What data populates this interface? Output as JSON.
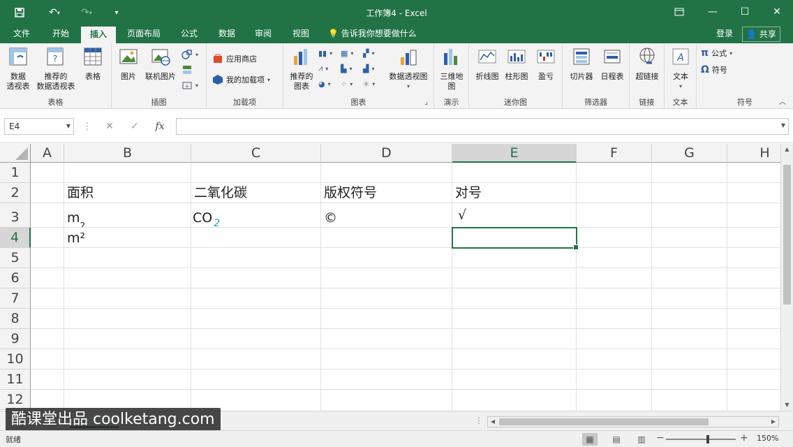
{
  "window": {
    "title": "工作簿4 - Excel"
  },
  "quick_access": {
    "save_icon": "save-icon",
    "undo_icon": "undo-icon",
    "redo_icon": "redo-icon"
  },
  "tabs": [
    {
      "label": "文件"
    },
    {
      "label": "开始"
    },
    {
      "label": "插入"
    },
    {
      "label": "页面布局"
    },
    {
      "label": "公式"
    },
    {
      "label": "数据"
    },
    {
      "label": "审阅"
    },
    {
      "label": "视图"
    }
  ],
  "tellme": "告诉我你想要做什么",
  "account": {
    "login": "登录",
    "share": "共享"
  },
  "ribbon": {
    "tables": {
      "label": "表格",
      "pivot": "数据\n透视表",
      "recommended_pivot": "推荐的\n数据透视表",
      "table": "表格"
    },
    "illustrations": {
      "label": "插图",
      "pictures": "图片",
      "online_pictures": "联机图片"
    },
    "addins": {
      "label": "加载项",
      "store": "应用商店",
      "my_addins": "我的加载项"
    },
    "charts": {
      "label": "图表",
      "recommended": "推荐的\n图表",
      "pivot_chart": "数据透视图"
    },
    "tours": {
      "label": "演示",
      "map3d": "三维地\n图"
    },
    "sparklines": {
      "label": "迷你图",
      "line": "折线图",
      "column": "柱形图",
      "winloss": "盈亏"
    },
    "filters": {
      "label": "筛选器",
      "slicer": "切片器",
      "timeline": "日程表"
    },
    "links": {
      "label": "链接",
      "hyperlink": "超链接"
    },
    "text": {
      "label": "文本",
      "text": "文本"
    },
    "symbols": {
      "label": "符号",
      "equation": "公式",
      "symbol": "符号"
    }
  },
  "formula_bar": {
    "name_box": "E4",
    "cancel": "✕",
    "enter": "✓",
    "fx": "fx",
    "value": ""
  },
  "columns": [
    "A",
    "B",
    "C",
    "D",
    "E",
    "F",
    "G",
    "H"
  ],
  "rows": [
    "1",
    "2",
    "3",
    "4",
    "5",
    "6",
    "7",
    "8",
    "9",
    "10",
    "11",
    "12"
  ],
  "cells": {
    "B2": "面积",
    "C2": "二氧化碳",
    "D2": "版权符号",
    "E2": "对号",
    "B3_base": "m",
    "B3_sup": "2",
    "C3_base": "CO",
    "C3_sub": "2",
    "D3": "©",
    "E3": "√",
    "B4": "m²"
  },
  "selected_cell": "E4",
  "watermark": "酷课堂出品 coolketang.com",
  "status": {
    "ready": "就绪",
    "zoom": "150%"
  }
}
